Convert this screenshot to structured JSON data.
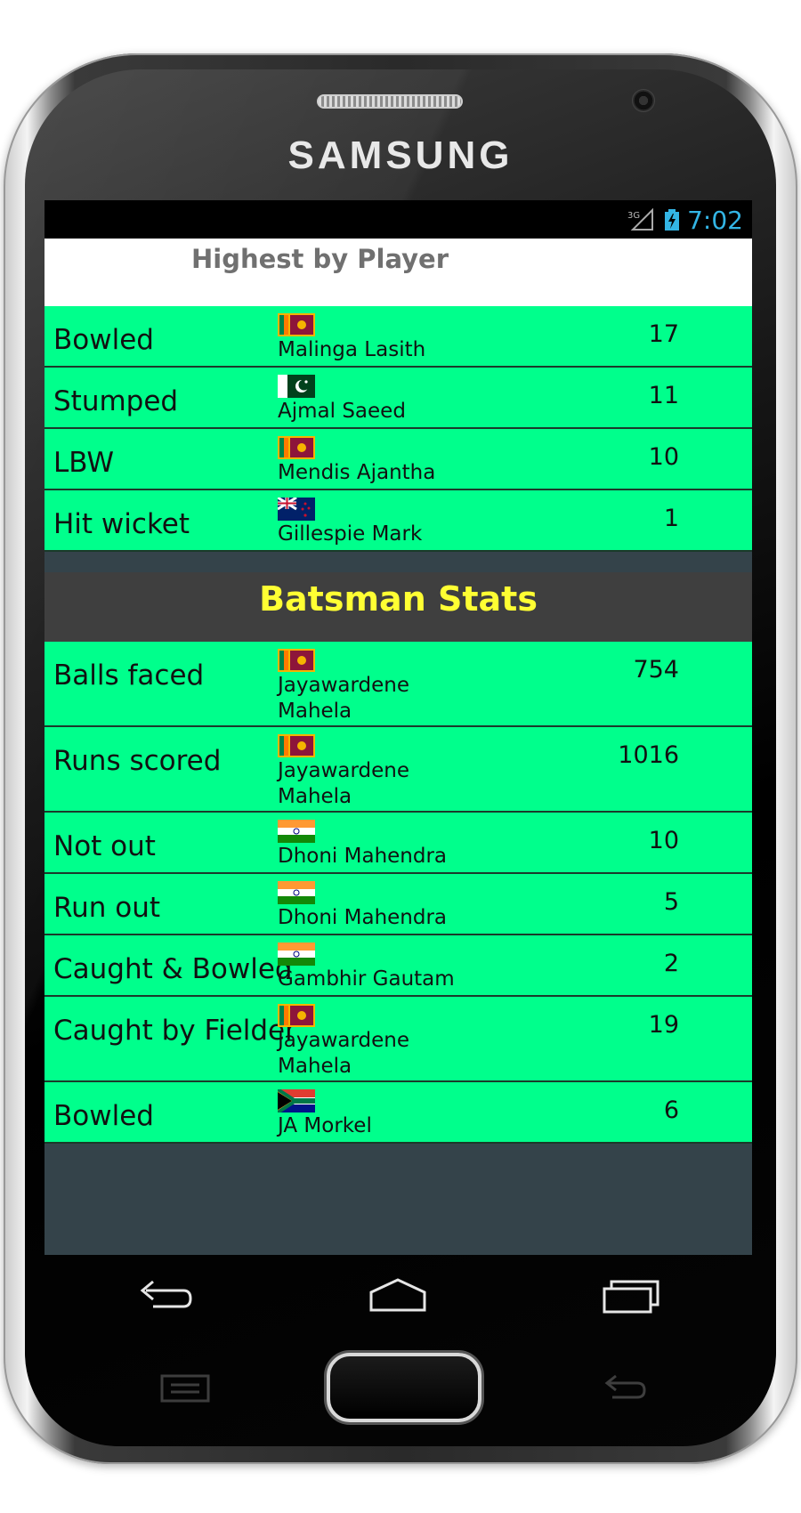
{
  "device": {
    "brand": "SAMSUNG"
  },
  "status_bar": {
    "network": "3G",
    "time": "7:02"
  },
  "header": {
    "title": "Highest by Player"
  },
  "bowler_rows": [
    {
      "category": "Bowled",
      "flag": "sri-lanka",
      "player": "Malinga Lasith",
      "value": "17"
    },
    {
      "category": "Stumped",
      "flag": "pakistan",
      "player": "Ajmal Saeed",
      "value": "11"
    },
    {
      "category": "LBW",
      "flag": "sri-lanka",
      "player": "Mendis Ajantha",
      "value": "10"
    },
    {
      "category": "Hit wicket",
      "flag": "new-zealand",
      "player": "Gillespie Mark",
      "value": "1"
    }
  ],
  "batsman_section": {
    "title": "Batsman Stats"
  },
  "batsman_rows": [
    {
      "category": "Balls faced",
      "flag": "sri-lanka",
      "player": "Jayawardene Mahela",
      "value": "754"
    },
    {
      "category": "Runs scored",
      "flag": "sri-lanka",
      "player": "Jayawardene Mahela",
      "value": "1016"
    },
    {
      "category": "Not out",
      "flag": "india",
      "player": "Dhoni Mahendra",
      "value": "10"
    },
    {
      "category": "Run out",
      "flag": "india",
      "player": "Dhoni Mahendra",
      "value": "5"
    },
    {
      "category": "Caught & Bowled",
      "flag": "india",
      "player": "Gambhir Gautam",
      "value": "2"
    },
    {
      "category": "Caught by Fielder",
      "flag": "sri-lanka",
      "player": "Jayawardene Mahela",
      "value": "19"
    },
    {
      "category": "Bowled",
      "flag": "south-africa",
      "player": "JA Morkel",
      "value": "6"
    }
  ],
  "navigation": {
    "back": "back-icon",
    "home": "home-icon",
    "recents": "recent-apps-icon"
  },
  "colors": {
    "row_bg": "#00ff8c",
    "section_bg": "#3f3f3f",
    "section_text": "#ffff33",
    "status_time": "#33b5e5",
    "screen_bg": "#34434a"
  }
}
